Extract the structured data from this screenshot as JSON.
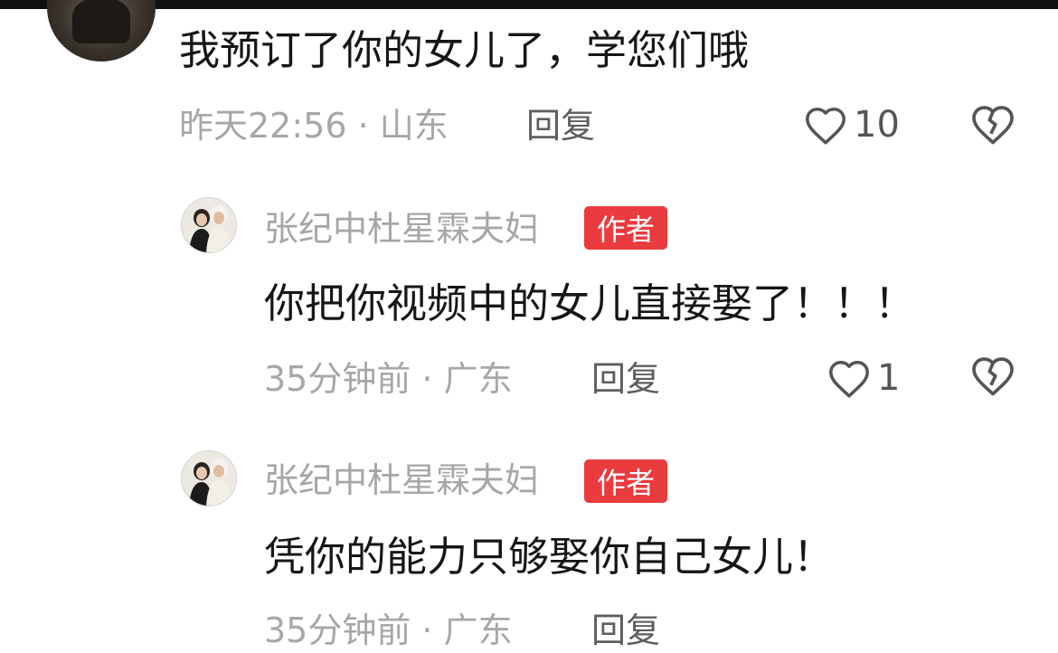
{
  "comments": [
    {
      "text": "我预订了你的女儿了，学您们哦",
      "time_location": "昨天22:56 · 山东",
      "reply_label": "回复",
      "like_count": "10"
    },
    {
      "username": "张纪中杜星霖夫妇",
      "badge": "作者",
      "text": "你把你视频中的女儿直接娶了！！！",
      "time_location": "35分钟前 · 广东",
      "reply_label": "回复",
      "like_count": "1"
    },
    {
      "username": "张纪中杜星霖夫妇",
      "badge": "作者",
      "text": "凭你的能力只够娶你自己女儿！",
      "time_location_partial": "35分钟前 · 广东",
      "reply_label": "回复"
    }
  ],
  "icons": [
    "heart-outline-icon",
    "broken-heart-icon"
  ],
  "colors": {
    "badge": "#ea3b3f",
    "meta_text": "#a7a7a7",
    "body_text": "#161616"
  }
}
